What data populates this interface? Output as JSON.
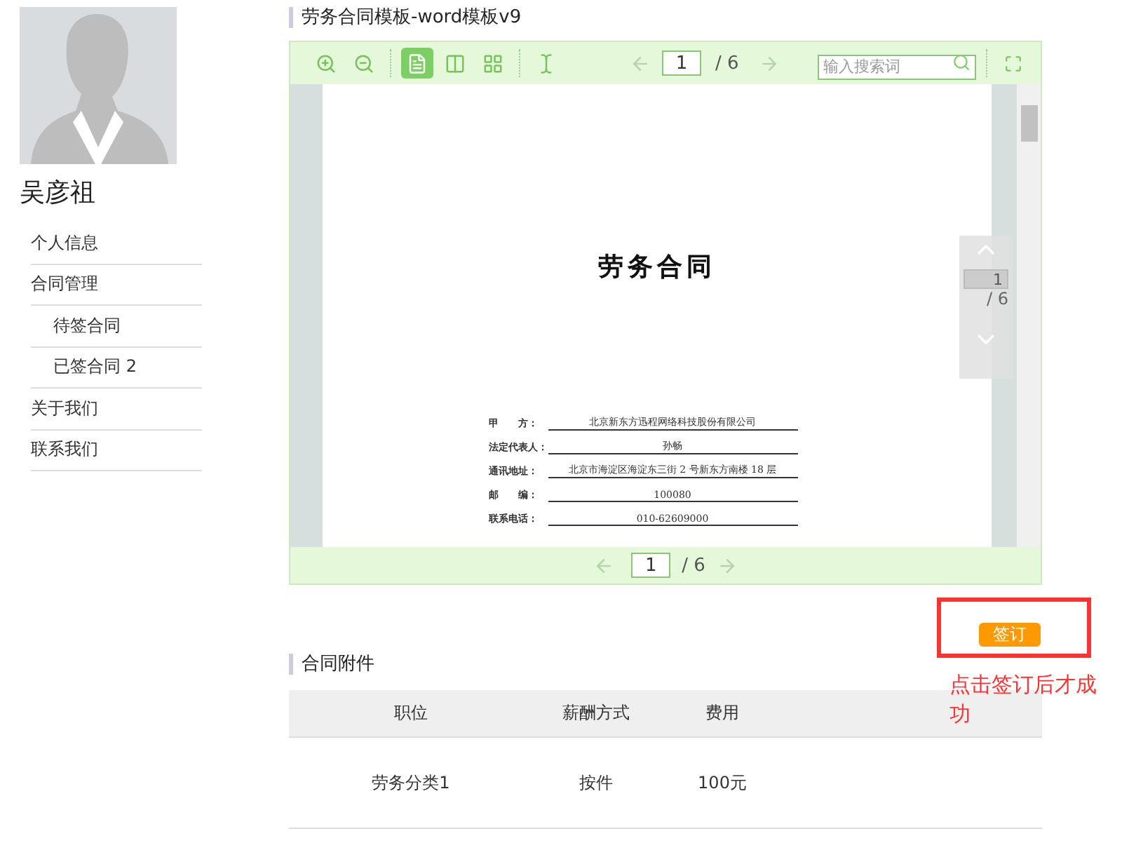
{
  "user": {
    "name": "吴彦祖"
  },
  "menu": [
    {
      "label": "个人信息"
    },
    {
      "label": "合同管理",
      "children": [
        {
          "label": "待签合同"
        },
        {
          "label": "已签合同 2"
        }
      ]
    },
    {
      "label": "关于我们"
    },
    {
      "label": "联系我们"
    }
  ],
  "document": {
    "title": "劳务合同模板-word模板v9",
    "toolbar": {
      "views": [
        {
          "kind": "single",
          "selected": true
        },
        {
          "kind": "double",
          "selected": false
        },
        {
          "kind": "grid",
          "selected": false
        }
      ],
      "page": "1",
      "total": "/ 6",
      "search_placeholder": "输入搜索词"
    },
    "page_title": "劳务合同",
    "fields": [
      {
        "label": "甲　　方：",
        "value": "北京新东方迅程网络科技股份有限公司"
      },
      {
        "label": "法定代表人：",
        "value": "孙畅"
      },
      {
        "label": "通讯地址：",
        "value": "北京市海淀区海淀东三街 2 号新东方南楼 18 层"
      },
      {
        "label": "邮　　编：",
        "value": "100080"
      },
      {
        "label": "联系电话：",
        "value": "010-62609000"
      }
    ],
    "side_nav": {
      "page": "1",
      "total": "/ 6"
    },
    "footer": {
      "page": "1",
      "total": "/ 6"
    }
  },
  "sign_button": "签订",
  "annotation": "点击签订后才成功",
  "attachments": {
    "title": "合同附件",
    "columns": [
      "职位",
      "薪酬方式",
      "费用"
    ],
    "rows": [
      [
        "劳务分类1",
        "按件",
        "100元"
      ]
    ]
  }
}
